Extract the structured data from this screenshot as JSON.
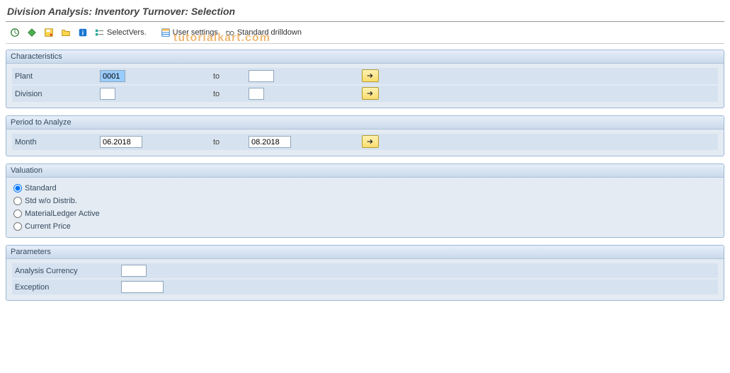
{
  "title": "Division Analysis: Inventory Turnover: Selection",
  "watermark": "tutorialkart.com",
  "toolbar": {
    "selectvers": "SelectVers.",
    "usersettings": "User settings",
    "stddrill": "Standard drilldown"
  },
  "groups": {
    "characteristics": {
      "title": "Characteristics",
      "plant_lbl": "Plant",
      "plant_from": "0001",
      "plant_to": "",
      "division_lbl": "Division",
      "division_from": "",
      "division_to": "",
      "to_lbl": "to"
    },
    "period": {
      "title": "Period to Analyze",
      "month_lbl": "Month",
      "month_from": "06.2018",
      "month_to": "08.2018",
      "to_lbl": "to"
    },
    "valuation": {
      "title": "Valuation",
      "opt_standard": "Standard",
      "opt_std_wo": "Std w/o Distrib.",
      "opt_ml_active": "MaterialLedger Active",
      "opt_current": "Current Price"
    },
    "parameters": {
      "title": "Parameters",
      "analysis_curr_lbl": "Analysis Currency",
      "analysis_curr_val": "",
      "exception_lbl": "Exception",
      "exception_val": ""
    }
  }
}
